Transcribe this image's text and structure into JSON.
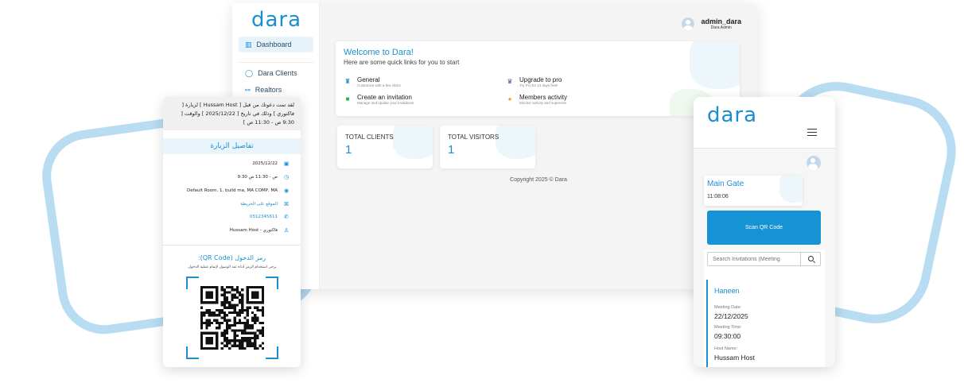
{
  "dashboard": {
    "logo": "dara",
    "sidebar": [
      {
        "label": "Dashboard",
        "icon": "bar-chart-icon",
        "active": true
      },
      {
        "label": "Dara Clients",
        "icon": "user-icon"
      },
      {
        "label": "Realtors",
        "icon": "handshake-icon"
      }
    ],
    "sidebar_partial": "rs",
    "user": {
      "name": "admin_dara",
      "role": "Dara Admin"
    },
    "welcome": {
      "title": "Welcome to Dara!",
      "subtitle": "Here are some quick links for you to start",
      "links": [
        {
          "title": "General",
          "desc": "Customize with a few clicks",
          "icon": "building-icon"
        },
        {
          "title": "Upgrade to pro",
          "desc": "Try Pro for 14 days free!",
          "icon": "crown-icon"
        },
        {
          "title": "Create an invitation",
          "desc": "Manage and update your invitations",
          "icon": "video-icon"
        },
        {
          "title": "Members activity",
          "desc": "Monitor activity and supervise",
          "icon": "person-icon"
        }
      ]
    },
    "stats": [
      {
        "label": "TOTAL CLIENTS",
        "value": "1"
      },
      {
        "label": "TOTAL VISITORS",
        "value": "1"
      }
    ],
    "copyright": "Copyright 2025 © Dara"
  },
  "invitation": {
    "message": "لقد تمت دعوتك من قبل [ Hussam Host ] لزيارة [ فاكتوري ] وذلك في تاريخ [ 2025/12/22 ] والوقت [ 9:30 ص - 11:30 ص ]",
    "details_title": "تفاصيل الزيارة",
    "date": "2025/12/22",
    "time": "9:30 ص - 11:30 ص",
    "location": "Default Room, 1, build ma, MA COMP, MA",
    "map_link": "الموقع على الخريطة",
    "phone": "0512345611",
    "host": "Hussam Host - فاكتوري",
    "qr_title": "رمز الدخول (QR Code):",
    "qr_note": "يرجى استخدام الرمز أدناه عند الوصول لإتمام عملية الدخول."
  },
  "gate": {
    "logo": "dara",
    "gate_name": "Main Gate",
    "time": "11:08:06",
    "scan_label": "Scan QR Code",
    "search_placeholder": "Search Invitations (Meeting",
    "visit": {
      "name": "Haneen",
      "date_label": "Meeting Date:",
      "date": "22/12/2025",
      "time_label": "Meeting Time:",
      "time": "09:30:00",
      "host_label": "Host Name:",
      "host": "Hussam Host"
    }
  },
  "colors": {
    "accent": "#1a8fcf",
    "button": "#1593d4",
    "deco": "#b8dcf2"
  }
}
